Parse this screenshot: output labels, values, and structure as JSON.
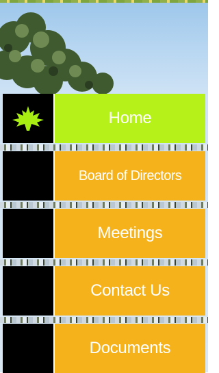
{
  "nav": {
    "items": [
      {
        "label": "Home",
        "active": true,
        "icon": "maple-leaf-icon"
      },
      {
        "label": "Board of Directors",
        "active": false,
        "icon": ""
      },
      {
        "label": "Meetings",
        "active": false,
        "icon": ""
      },
      {
        "label": "Contact Us",
        "active": false,
        "icon": ""
      },
      {
        "label": "Documents",
        "active": false,
        "icon": ""
      }
    ]
  },
  "colors": {
    "active_bg": "#b6f21a",
    "inactive_bg": "#f5b21b",
    "icon_bg": "#000000",
    "leaf": "#a8ee12",
    "label_text": "#ffffff"
  }
}
